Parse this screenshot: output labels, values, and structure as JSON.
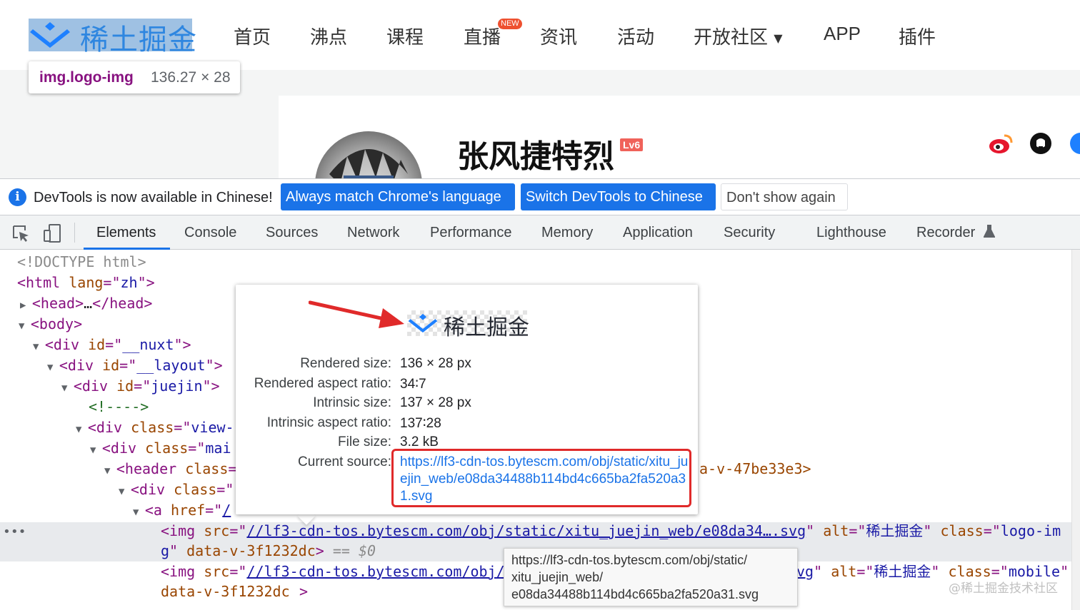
{
  "site": {
    "logo_text": "稀土掘金",
    "nav": [
      {
        "label": "首页"
      },
      {
        "label": "沸点"
      },
      {
        "label": "课程"
      },
      {
        "label": "直播",
        "badge": "NEW"
      },
      {
        "label": "资讯"
      },
      {
        "label": "活动"
      },
      {
        "label": "开放社区"
      },
      {
        "label": "APP"
      },
      {
        "label": "插件"
      }
    ],
    "logo_tooltip": {
      "selector": "img.logo-img",
      "size": "136.27 × 28"
    },
    "profile": {
      "name": "张风捷特烈",
      "level": "Lv6"
    },
    "social_icons": [
      "weibo-icon",
      "github-icon",
      "blog-icon"
    ]
  },
  "devtools": {
    "infobar": {
      "message": "DevTools is now available in Chinese!",
      "btn_match": "Always match Chrome's language",
      "btn_switch": "Switch DevTools to Chinese",
      "btn_dismiss": "Don't show again"
    },
    "tabs": [
      "Elements",
      "Console",
      "Sources",
      "Network",
      "Performance",
      "Memory",
      "Application",
      "Security",
      "Lighthouse",
      "Recorder"
    ],
    "active_tab": "Elements",
    "tree": {
      "doctype": "<!DOCTYPE html>",
      "html_attr": "lang",
      "html_val": "zh",
      "head_collapsed": "…",
      "nuxt_id": "__nuxt",
      "layout_id": "__layout",
      "juejin_id": "juejin",
      "comment": "<!---->",
      "view_cls": "view-",
      "main_cls": "mai",
      "header_tail": "a-v-47be33e3>",
      "a_href_part": "/",
      "img1_src": "//lf3-cdn-tos.bytescm.com/obj/static/xitu_juejin_web/e08da34….svg",
      "img1_alt": "稀土掘金",
      "img1_class_a": "logo-im",
      "img1_class_b": "g",
      "data_attr": "data-v-3f1232dc",
      "dollar": "== $0",
      "img2_src": "//lf3-cdn-tos.bytescm.com/obj/",
      "img2_tail": "vg",
      "img2_alt": "稀土掘金",
      "img2_class": "mobile"
    },
    "preview": {
      "logo_text": "稀土掘金",
      "rendered_size_label": "Rendered size:",
      "rendered_size": "136 × 28 px",
      "rendered_ratio_label": "Rendered aspect ratio:",
      "rendered_ratio": "34∶7",
      "intrinsic_size_label": "Intrinsic size:",
      "intrinsic_size": "137 × 28 px",
      "intrinsic_ratio_label": "Intrinsic aspect ratio:",
      "intrinsic_ratio": "137∶28",
      "file_size_label": "File size:",
      "file_size": "3.2 kB",
      "source_label": "Current source:",
      "source_url": "https://lf3-cdn-tos.bytescm.com/obj/static/xitu_juejin_web/e08da34488b114bd4c665ba2fa520a31.svg"
    },
    "url_tooltip": {
      "line1": "https://lf3-cdn-tos.bytescm.com/obj/static/",
      "line2": "xitu_juejin_web/",
      "line3": "e08da34488b114bd4c665ba2fa520a31.svg"
    }
  },
  "watermark": "@稀土掘金技术社区",
  "colors": {
    "brand_blue": "#1e80ff",
    "devtools_blue": "#1a73e8",
    "highlight_red": "#e02a2a"
  }
}
